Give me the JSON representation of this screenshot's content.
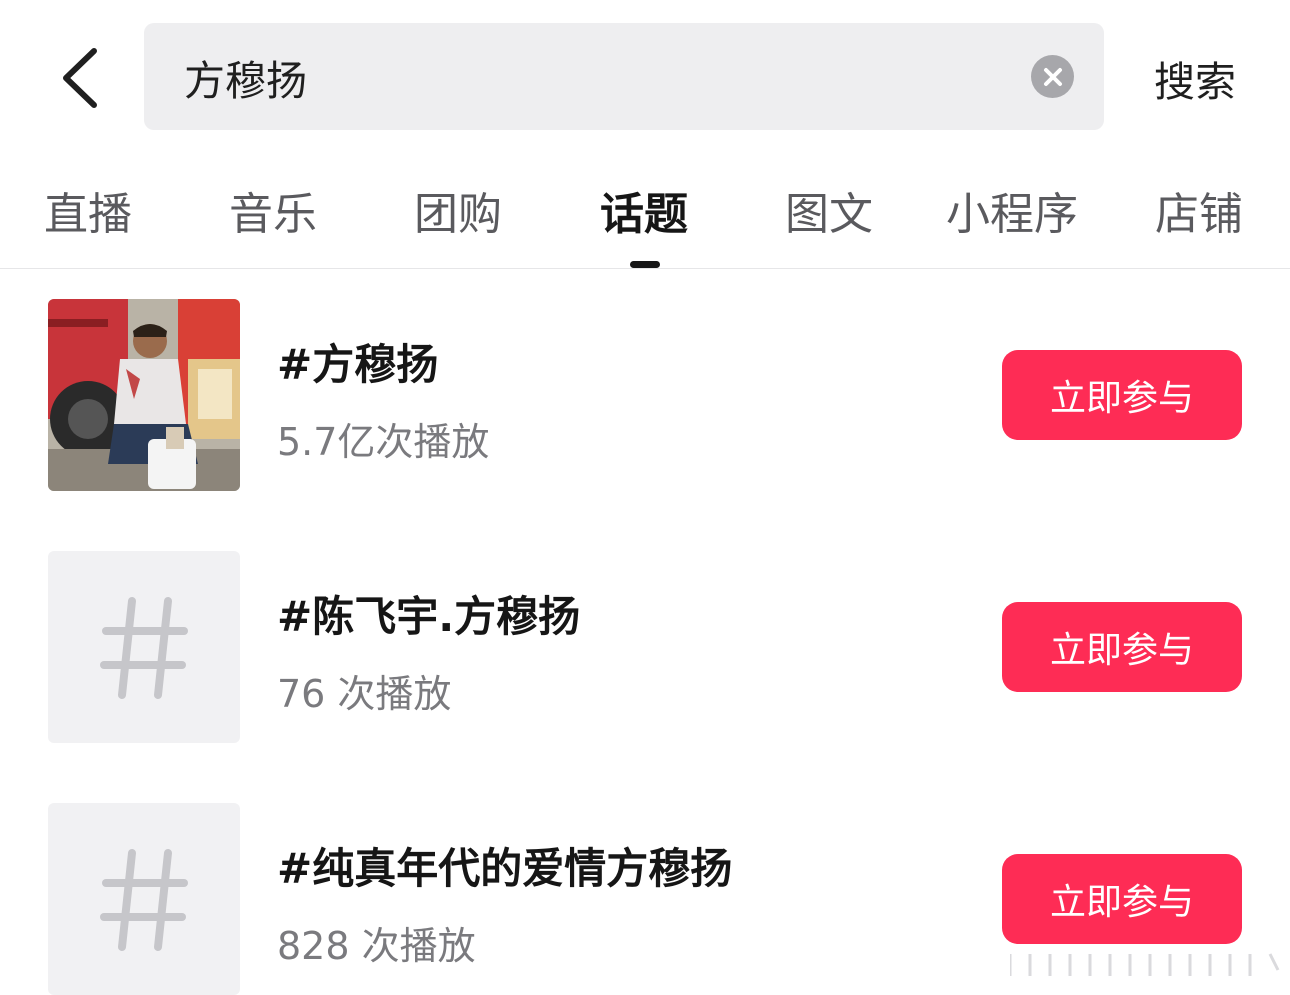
{
  "search": {
    "query": "方穆扬",
    "submit_label": "搜索"
  },
  "tabs": [
    {
      "label": "直播",
      "active": false
    },
    {
      "label": "音乐",
      "active": false
    },
    {
      "label": "团购",
      "active": false
    },
    {
      "label": "话题",
      "active": true
    },
    {
      "label": "图文",
      "active": false
    },
    {
      "label": "小程序",
      "active": false
    },
    {
      "label": "店铺",
      "active": false
    }
  ],
  "topics": [
    {
      "title": "#方穆扬",
      "plays": "5.7亿次播放",
      "button": "立即参与",
      "thumbnail": "photo"
    },
    {
      "title": "#陈飞宇.方穆扬",
      "plays": "76 次播放",
      "button": "立即参与",
      "thumbnail": "hash-icon"
    },
    {
      "title": "#纯真年代的爱情方穆扬",
      "plays": "828 次播放",
      "button": "立即参与",
      "thumbnail": "hash-icon"
    }
  ],
  "colors": {
    "accent": "#fe2c55",
    "search_bg": "#eeeef0",
    "placeholder_bg": "#f1f1f3"
  }
}
